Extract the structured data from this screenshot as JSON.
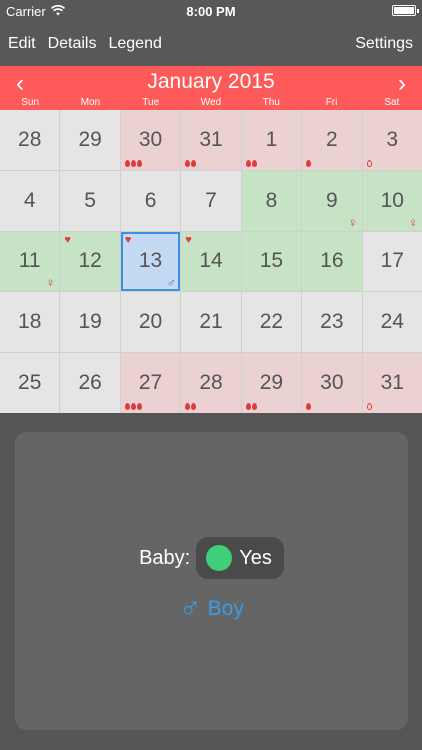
{
  "status_bar": {
    "carrier": "Carrier",
    "time": "8:00 PM"
  },
  "nav": {
    "edit": "Edit",
    "details": "Details",
    "legend": "Legend",
    "settings": "Settings"
  },
  "calendar": {
    "month_title": "January 2015",
    "prev": "‹",
    "next": "›",
    "weekdays": [
      "Sun",
      "Mon",
      "Tue",
      "Wed",
      "Thu",
      "Fri",
      "Sat"
    ],
    "days": [
      {
        "n": "28",
        "bg": "grey"
      },
      {
        "n": "29",
        "bg": "grey"
      },
      {
        "n": "30",
        "bg": "period",
        "drops": 3
      },
      {
        "n": "31",
        "bg": "period",
        "drops": 2
      },
      {
        "n": "1",
        "bg": "period",
        "drops": 2
      },
      {
        "n": "2",
        "bg": "period",
        "drops": 1
      },
      {
        "n": "3",
        "bg": "period",
        "drops": 1,
        "outline": true
      },
      {
        "n": "4",
        "bg": "grey"
      },
      {
        "n": "5",
        "bg": "grey"
      },
      {
        "n": "6",
        "bg": "grey"
      },
      {
        "n": "7",
        "bg": "grey"
      },
      {
        "n": "8",
        "bg": "fertile"
      },
      {
        "n": "9",
        "bg": "fertile",
        "gender": "venus"
      },
      {
        "n": "10",
        "bg": "fertile",
        "gender": "venus"
      },
      {
        "n": "11",
        "bg": "fertile",
        "gender": "venus"
      },
      {
        "n": "12",
        "bg": "fertile",
        "heart": true
      },
      {
        "n": "13",
        "bg": "selected",
        "heart": true,
        "gender": "mars"
      },
      {
        "n": "14",
        "bg": "fertile",
        "heart": true
      },
      {
        "n": "15",
        "bg": "fertile"
      },
      {
        "n": "16",
        "bg": "fertile"
      },
      {
        "n": "17",
        "bg": "grey"
      },
      {
        "n": "18",
        "bg": "grey"
      },
      {
        "n": "19",
        "bg": "grey"
      },
      {
        "n": "20",
        "bg": "grey"
      },
      {
        "n": "21",
        "bg": "grey"
      },
      {
        "n": "22",
        "bg": "grey"
      },
      {
        "n": "23",
        "bg": "grey"
      },
      {
        "n": "24",
        "bg": "grey"
      },
      {
        "n": "25",
        "bg": "grey"
      },
      {
        "n": "26",
        "bg": "grey"
      },
      {
        "n": "27",
        "bg": "period",
        "drops": 3
      },
      {
        "n": "28",
        "bg": "period",
        "drops": 2
      },
      {
        "n": "29",
        "bg": "period",
        "drops": 2
      },
      {
        "n": "30",
        "bg": "period",
        "drops": 1
      },
      {
        "n": "31",
        "bg": "period",
        "drops": 1,
        "outline": true
      }
    ]
  },
  "detail": {
    "baby_label": "Baby:",
    "yes_label": "Yes",
    "gender_symbol": "♂",
    "gender_label": "Boy"
  },
  "colors": {
    "accent_red": "#fe5a5a",
    "fertile_green": "#c7e3c6",
    "period_pink": "#ebd1d1",
    "selected_blue": "#c4daf2",
    "boy_blue": "#3a9ce6",
    "yes_green": "#3ecf78"
  }
}
